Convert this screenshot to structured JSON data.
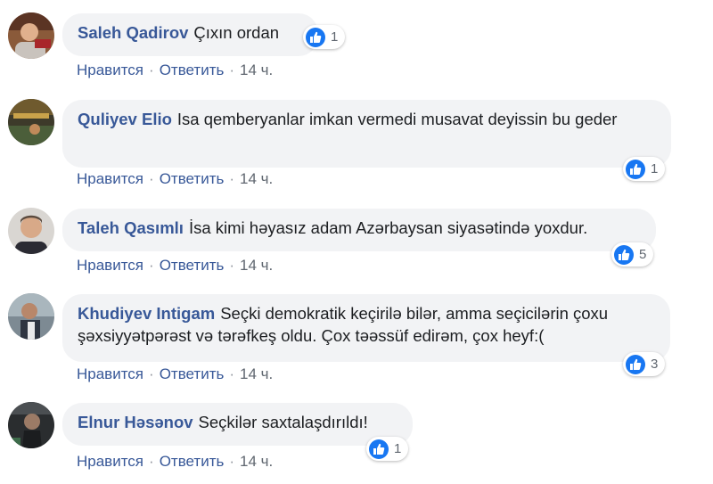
{
  "comments": [
    {
      "author": "Saleh Qadirov",
      "text": "Çıxın ordan",
      "reactions": "1",
      "actions": {
        "like": "Нравится",
        "reply": "Ответить",
        "time": "14 ч."
      }
    },
    {
      "author": "Quliyev Elio",
      "text": "Isa qemberyanlar imkan vermedi musavat deyissin bu geder",
      "reactions": "1",
      "actions": {
        "like": "Нравится",
        "reply": "Ответить",
        "time": "14 ч."
      }
    },
    {
      "author": "Taleh Qasımlı",
      "text": "İsa kimi həyasız adam Azərbaysan siyasətində yoxdur.",
      "reactions": "5",
      "actions": {
        "like": "Нравится",
        "reply": "Ответить",
        "time": "14 ч."
      }
    },
    {
      "author": "Khudiyev Intigam",
      "text": "Seçki demokratik keçirilə bilər, amma seçicilərin çoxu şəxsiyyətpərəst və tərəfkeş oldu. Çox təəssüf edirəm, çox heyf:(",
      "reactions": "3",
      "actions": {
        "like": "Нравится",
        "reply": "Ответить",
        "time": "14 ч."
      }
    },
    {
      "author": "Elnur Həsənov",
      "text": "Seçkilər saxtalaşdırıldı!",
      "reactions": "1",
      "actions": {
        "like": "Нравится",
        "reply": "Ответить",
        "time": "14 ч."
      }
    }
  ],
  "separator": "·",
  "colors": {
    "author": "#385898",
    "bubble": "#f2f3f5",
    "like": "#1877f2"
  },
  "icons": {
    "reaction": "like-icon"
  }
}
